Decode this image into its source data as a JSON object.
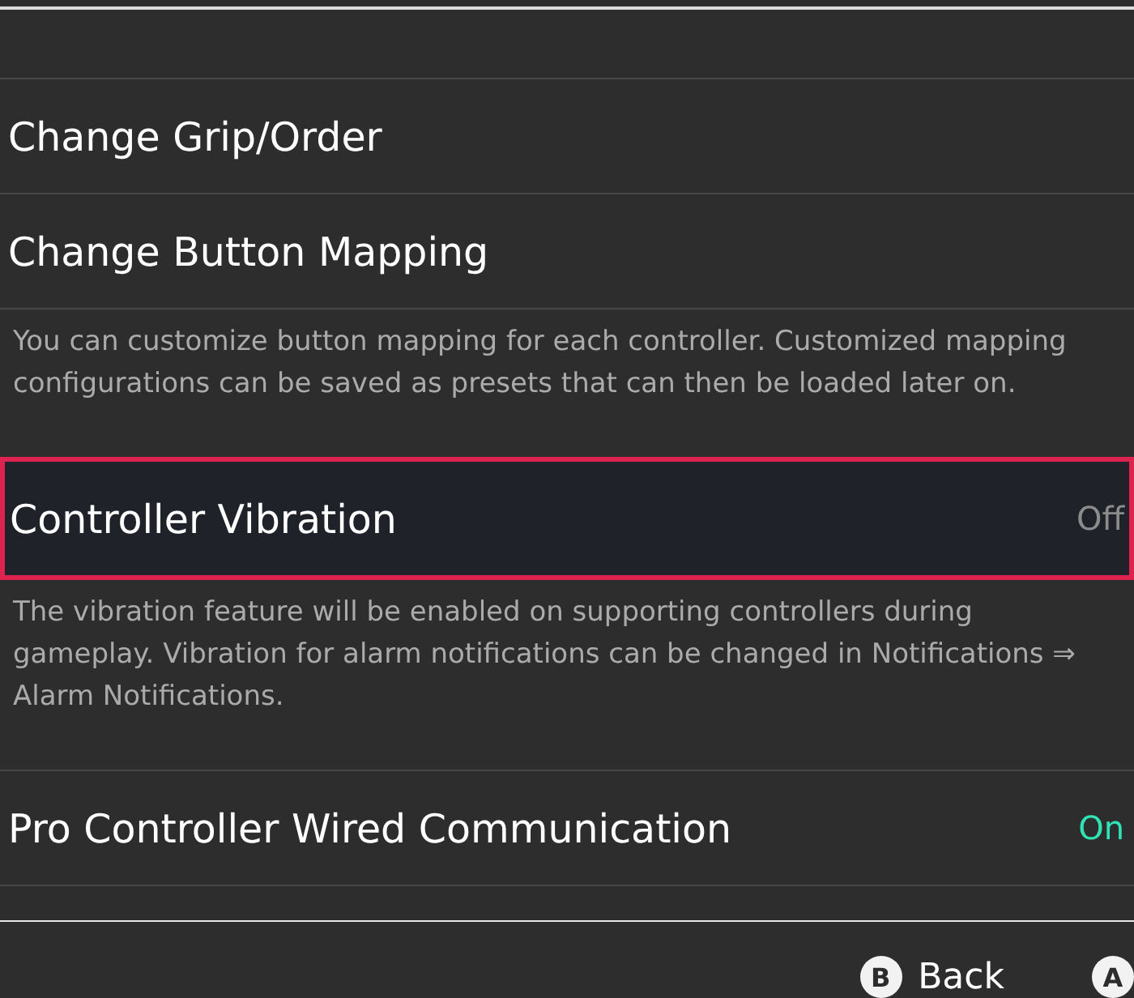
{
  "items": [
    {
      "kind": "setting",
      "label": "Change Grip/Order",
      "selected": false
    },
    {
      "kind": "setting",
      "label": "Change Button Mapping",
      "selected": false,
      "description": "You can customize button mapping for each controller. Customized mapping configurations can be saved as presets that can then be loaded later on."
    },
    {
      "kind": "toggle",
      "label": "Controller Vibration",
      "selected": true,
      "on": false,
      "value": "Off",
      "description": "The vibration feature will be enabled on supporting controllers during gameplay. Vibration for alarm notifications can be changed in Notifications ⇒ Alarm Notifications."
    },
    {
      "kind": "toggle",
      "label": "Pro Controller Wired Communication",
      "selected": false,
      "on": true,
      "value": "On"
    }
  ],
  "footer": {
    "actions": [
      {
        "glyph": "B",
        "label": "Back"
      },
      {
        "glyph": "A"
      }
    ]
  }
}
